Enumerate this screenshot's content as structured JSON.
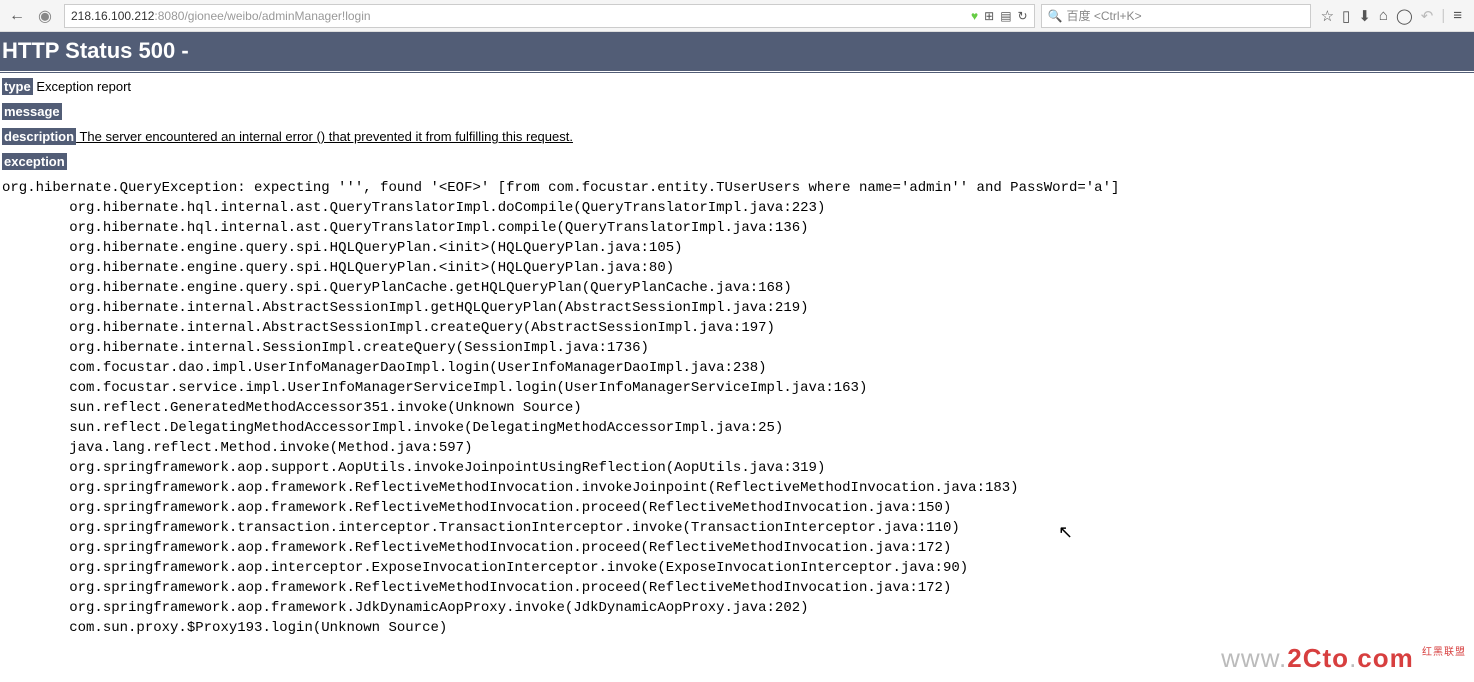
{
  "browser": {
    "url_prefix": "218.16.100.212",
    "url_suffix": ":8080/gionee/weibo/adminManager!login",
    "search_placeholder": "百度 <Ctrl+K>"
  },
  "page": {
    "heading": "HTTP Status 500 -",
    "type_label": "type",
    "type_value": " Exception report",
    "message_label": "message",
    "description_label": "description",
    "description_value": " The server encountered an internal error () that prevented it from fulfilling this request.",
    "exception_label": "exception",
    "stacktrace": "org.hibernate.QueryException: expecting ''', found '<EOF>' [from com.focustar.entity.TUserUsers where name='admin'' and PassWord='a']\n\torg.hibernate.hql.internal.ast.QueryTranslatorImpl.doCompile(QueryTranslatorImpl.java:223)\n\torg.hibernate.hql.internal.ast.QueryTranslatorImpl.compile(QueryTranslatorImpl.java:136)\n\torg.hibernate.engine.query.spi.HQLQueryPlan.<init>(HQLQueryPlan.java:105)\n\torg.hibernate.engine.query.spi.HQLQueryPlan.<init>(HQLQueryPlan.java:80)\n\torg.hibernate.engine.query.spi.QueryPlanCache.getHQLQueryPlan(QueryPlanCache.java:168)\n\torg.hibernate.internal.AbstractSessionImpl.getHQLQueryPlan(AbstractSessionImpl.java:219)\n\torg.hibernate.internal.AbstractSessionImpl.createQuery(AbstractSessionImpl.java:197)\n\torg.hibernate.internal.SessionImpl.createQuery(SessionImpl.java:1736)\n\tcom.focustar.dao.impl.UserInfoManagerDaoImpl.login(UserInfoManagerDaoImpl.java:238)\n\tcom.focustar.service.impl.UserInfoManagerServiceImpl.login(UserInfoManagerServiceImpl.java:163)\n\tsun.reflect.GeneratedMethodAccessor351.invoke(Unknown Source)\n\tsun.reflect.DelegatingMethodAccessorImpl.invoke(DelegatingMethodAccessorImpl.java:25)\n\tjava.lang.reflect.Method.invoke(Method.java:597)\n\torg.springframework.aop.support.AopUtils.invokeJoinpointUsingReflection(AopUtils.java:319)\n\torg.springframework.aop.framework.ReflectiveMethodInvocation.invokeJoinpoint(ReflectiveMethodInvocation.java:183)\n\torg.springframework.aop.framework.ReflectiveMethodInvocation.proceed(ReflectiveMethodInvocation.java:150)\n\torg.springframework.transaction.interceptor.TransactionInterceptor.invoke(TransactionInterceptor.java:110)\n\torg.springframework.aop.framework.ReflectiveMethodInvocation.proceed(ReflectiveMethodInvocation.java:172)\n\torg.springframework.aop.interceptor.ExposeInvocationInterceptor.invoke(ExposeInvocationInterceptor.java:90)\n\torg.springframework.aop.framework.ReflectiveMethodInvocation.proceed(ReflectiveMethodInvocation.java:172)\n\torg.springframework.aop.framework.JdkDynamicAopProxy.invoke(JdkDynamicAopProxy.java:202)\n\tcom.sun.proxy.$Proxy193.login(Unknown Source)"
  },
  "watermark": {
    "domain_prefix": "www.",
    "domain_mid": "2Cto",
    "domain_suffix": "com",
    "sub": "红黑联盟"
  }
}
